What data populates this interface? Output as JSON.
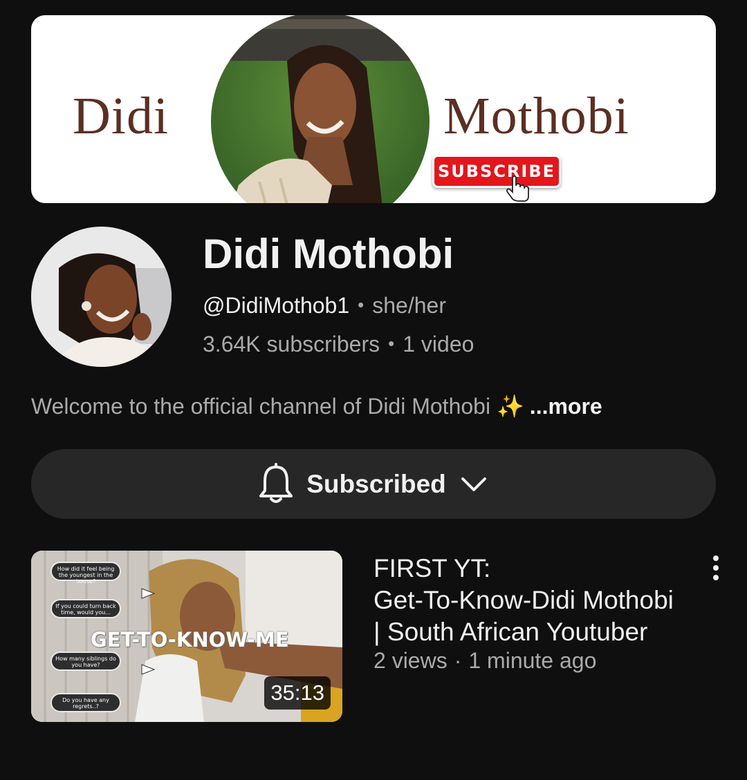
{
  "banner": {
    "left_word": "Didi",
    "right_word": "Mothobi",
    "subscribe_label": "SUBSCRIBE"
  },
  "channel": {
    "name": "Didi Mothobi",
    "handle": "@DidiMothob1",
    "pronouns": "she/her",
    "subscribers": "3.64K subscribers",
    "video_count": "1 video",
    "separator": "•",
    "description": "Welcome to the official channel of Didi Mothobi ✨",
    "more_label": "...more"
  },
  "subscribe_button": {
    "label": "Subscribed",
    "icon": "bell-icon",
    "dropdown_icon": "chevron-down-icon"
  },
  "video": {
    "title_lines": [
      "FIRST YT:",
      "Get-To-Know-Didi Mothobi",
      "| South African Youtuber"
    ],
    "views": "2 views",
    "separator": "·",
    "age": "1 minute ago",
    "duration": "35:13",
    "thumbnail_title": "GET-TO-KNOW-ME",
    "thumbnail_questions": [
      "How did it feel being the youngest in the house?",
      "If you could turn back time, would you...",
      "How many siblings do you have?",
      "Do you have any regrets..?"
    ]
  },
  "colors": {
    "background": "#0f0f0f",
    "button_bg": "#272727",
    "secondary_text": "#aaaaaa",
    "primary_text": "#f1f1f1",
    "banner_text": "#5b2f22",
    "subscribe_red": "#e3161b"
  }
}
